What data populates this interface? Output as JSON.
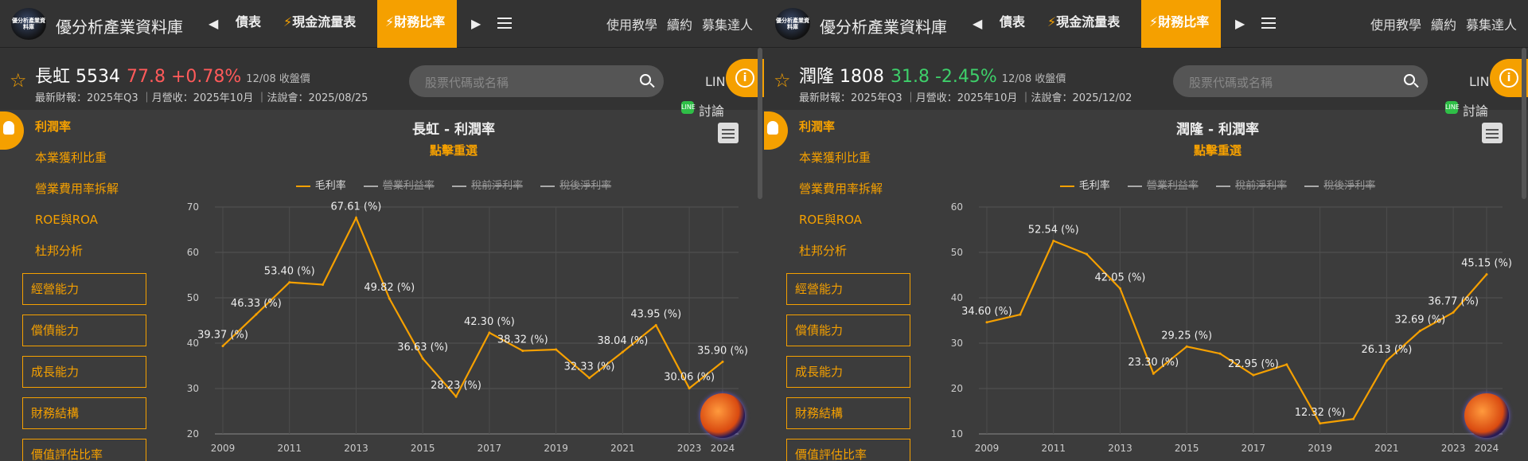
{
  "app": {
    "brand": "優分析產業資料庫",
    "logo_text": "優分析產業資料庫"
  },
  "nav": {
    "tabs": [
      {
        "label": "債表"
      },
      {
        "label": "現金流量表"
      },
      {
        "label": "財務比率"
      }
    ],
    "right_links": [
      "使用教學",
      "續約",
      "募集達人"
    ]
  },
  "search": {
    "placeholder": "股票代碼或名稱"
  },
  "social": {
    "line": "LIN",
    "discuss": "討論",
    "line_icon": "LINE"
  },
  "panels": [
    {
      "stock": {
        "name": "長虹 5534",
        "price": "77.8",
        "change": "+0.78%",
        "direction": "up",
        "date": "12/08 收盤價"
      },
      "sub_info": "最新財報：2025年Q3 ｜月營收：2025年10月 ｜法說會：2025/08/25",
      "chart_title": "長虹 - 利潤率",
      "chart_subtitle": "點擊重選"
    },
    {
      "stock": {
        "name": "潤隆 1808",
        "price": "31.8",
        "change": "-2.45%",
        "direction": "down",
        "date": "12/08 收盤價"
      },
      "sub_info": "最新財報：2025年Q3 ｜月營收：2025年10月 ｜法說會：2025/12/02",
      "chart_title": "潤隆 - 利潤率",
      "chart_subtitle": "點擊重選"
    }
  ],
  "sidebar": {
    "links": [
      "利潤率",
      "本業獲利比重",
      "營業費用率拆解",
      "ROE與ROA",
      "杜邦分析"
    ],
    "boxes": [
      "經營能力",
      "償債能力",
      "成長能力",
      "財務結構",
      "價值評估比率"
    ]
  },
  "legend": [
    {
      "label": "毛利率",
      "enabled": true
    },
    {
      "label": "營業利益率",
      "enabled": false
    },
    {
      "label": "稅前淨利率",
      "enabled": false
    },
    {
      "label": "稅後淨利率",
      "enabled": false
    }
  ],
  "colors": {
    "accent": "#f5a000",
    "up": "#ff5a5a",
    "down": "#3ecf6a"
  },
  "chart_data": [
    {
      "type": "line",
      "title": "長虹 - 利潤率",
      "x": [
        2009,
        2010,
        2011,
        2012,
        2013,
        2014,
        2015,
        2016,
        2017,
        2018,
        2019,
        2020,
        2021,
        2022,
        2023,
        2024
      ],
      "x_ticks": [
        "2009",
        "2011",
        "2013",
        "2015",
        "2017",
        "2019",
        "2021",
        "2023",
        "2024"
      ],
      "ylim": [
        20,
        70
      ],
      "y_ticks": [
        20,
        30,
        40,
        50,
        60,
        70
      ],
      "series": [
        {
          "name": "毛利率",
          "values": [
            39.37,
            46.33,
            53.4,
            52.9,
            67.61,
            49.82,
            36.63,
            28.23,
            42.3,
            38.32,
            38.6,
            32.33,
            38.04,
            43.95,
            30.06,
            35.9
          ],
          "labels": [
            "39.37 (%)",
            "46.33 (%)",
            "53.40 (%)",
            "",
            "67.61 (%)",
            "49.82 (%)",
            "36.63 (%)",
            "28.23 (%)",
            "42.30 (%)",
            "38.32 (%)",
            "",
            "32.33 (%)",
            "38.04 (%)",
            "43.95 (%)",
            "30.06 (%)",
            "35.90 (%)"
          ]
        }
      ]
    },
    {
      "type": "line",
      "title": "潤隆 - 利潤率",
      "x": [
        2009,
        2010,
        2011,
        2012,
        2013,
        2014,
        2015,
        2016,
        2017,
        2018,
        2019,
        2020,
        2021,
        2022,
        2023,
        2024
      ],
      "x_ticks": [
        "2009",
        "2011",
        "2013",
        "2015",
        "2017",
        "2019",
        "2021",
        "2023",
        "2024"
      ],
      "ylim": [
        10,
        60
      ],
      "y_ticks": [
        10,
        20,
        30,
        40,
        50,
        60
      ],
      "series": [
        {
          "name": "毛利率",
          "values": [
            34.6,
            36.3,
            52.54,
            49.6,
            42.05,
            23.3,
            29.25,
            27.7,
            22.95,
            25.3,
            12.32,
            13.3,
            26.13,
            32.69,
            36.77,
            45.15
          ],
          "labels": [
            "34.60 (%)",
            "",
            "52.54 (%)",
            "",
            "42.05 (%)",
            "23.30 (%)",
            "29.25 (%)",
            "",
            "22.95 (%)",
            "",
            "12.32 (%)",
            "",
            "26.13 (%)",
            "32.69 (%)",
            "36.77 (%)",
            "45.15 (%)"
          ]
        }
      ]
    }
  ]
}
